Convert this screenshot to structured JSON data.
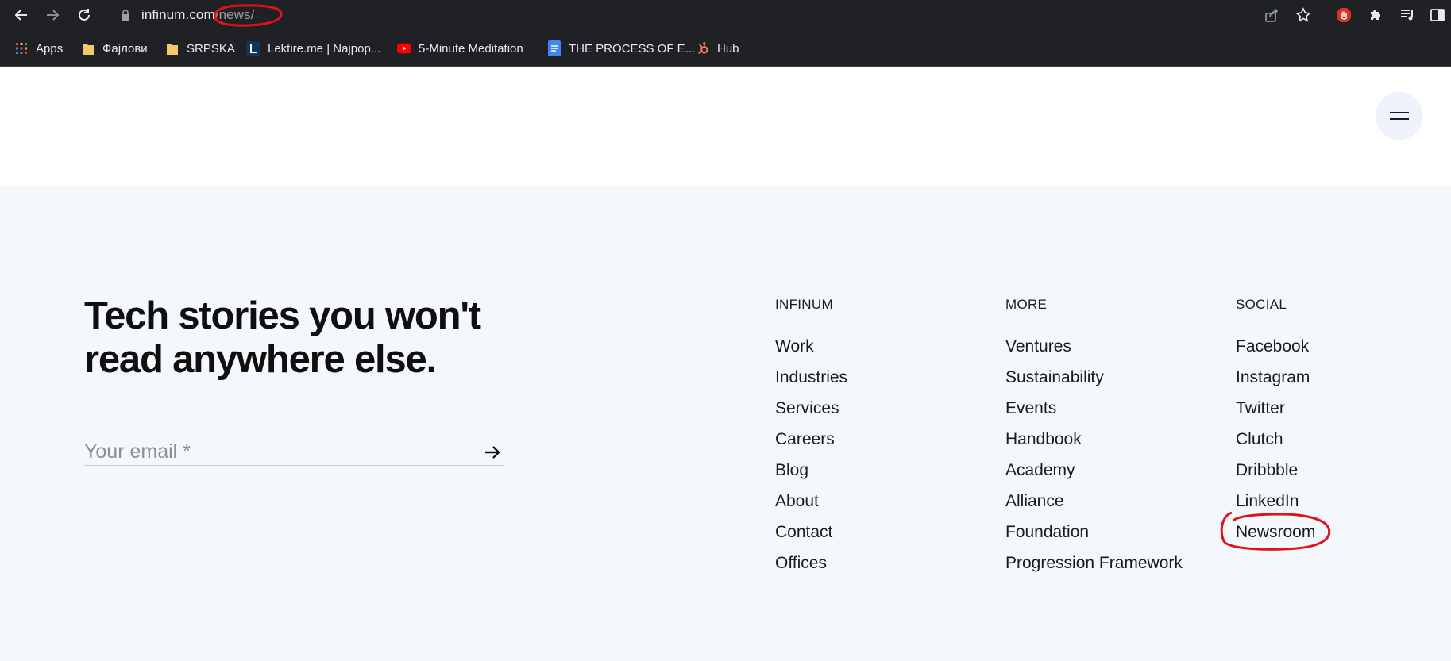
{
  "browser": {
    "url_host": "infinum.com",
    "url_path": "/news/",
    "bookmarks": [
      {
        "label": "Apps",
        "icon": "apps-grid-icon"
      },
      {
        "label": "Фајлови",
        "icon": "folder-icon"
      },
      {
        "label": "SRPSKA",
        "icon": "folder-icon"
      },
      {
        "label": "Lektire.me | Najpop...",
        "icon": "lektire-icon"
      },
      {
        "label": "5-Minute Meditation",
        "icon": "youtube-icon"
      },
      {
        "label": "THE PROCESS OF E...",
        "icon": "docs-icon"
      },
      {
        "label": "Hub",
        "icon": "hubspot-icon"
      }
    ]
  },
  "footer": {
    "headline_line1": "Tech stories you won't",
    "headline_line2": "read anywhere else.",
    "email_placeholder": "Your email *",
    "columns": [
      {
        "title": "INFINUM",
        "links": [
          "Work",
          "Industries",
          "Services",
          "Careers",
          "Blog",
          "About",
          "Contact",
          "Offices"
        ]
      },
      {
        "title": "MORE",
        "links": [
          "Ventures",
          "Sustainability",
          "Events",
          "Handbook",
          "Academy",
          "Alliance",
          "Foundation",
          "Progression Framework"
        ]
      },
      {
        "title": "SOCIAL",
        "links": [
          "Facebook",
          "Instagram",
          "Twitter",
          "Clutch",
          "Dribbble",
          "LinkedIn",
          "Newsroom"
        ]
      }
    ]
  },
  "colors": {
    "annotation_red": "#e0121b",
    "footer_bg": "#f4f7fc",
    "chrome_bg": "#202124"
  }
}
